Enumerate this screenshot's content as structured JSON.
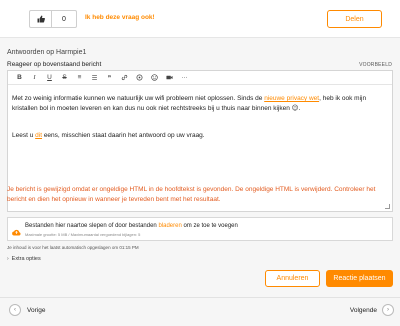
{
  "question_actions": {
    "like_count": "0",
    "same_question_label": "Ik heb deze vraag ook!",
    "share_label": "Delen"
  },
  "answers": {
    "heading": "Antwoorden op Harmpie1",
    "respond_label": "Reageer op bovenstaand bericht",
    "preview_label": "VOORBEELD"
  },
  "toolbar": {
    "bold": "B",
    "italic": "I",
    "underline": "U",
    "strike": "S",
    "list_ordered": "≡",
    "list_unordered": "☰",
    "quote": "❞",
    "link": "🔗",
    "image": "⊘",
    "emoji": "☺",
    "video": "■",
    "code": "<>",
    "more": "···"
  },
  "editor_content": {
    "p1_before": "Met zo weinig informatie kunnen we natuurlijk uw wifi probleem niet oplossen. Sinds de ",
    "p1_link": "nieuwe privacy wet",
    "p1_after": ", heb ik ook mijn kristallen bol in moeten leveren en kan dus nu ook niet rechtstreeks bij u thuis naar binnen kijken ",
    "p1_emoji": "😉",
    "p1_end": ".",
    "p2_before": "Leest u ",
    "p2_link": "dit",
    "p2_after": " eens, misschien staat daarin het antwoord op uw vraag."
  },
  "error_message": "Je bericht is gewijzigd omdat er ongeldige HTML in de hoofdtekst is gevonden. De ongeldige HTML is verwijderd. Controleer het bericht en dien het opnieuw in wanneer je tevreden bent met het resultaat.",
  "upload": {
    "text_before": "Bestanden hier naartoe slepen of door bestanden ",
    "browse_link": "bladeren",
    "text_after": " om ze toe te voegen",
    "limits": "Maximale grootte: 5 MB / Maximumaantal vergoedend bijlagen: 5"
  },
  "autosave": "Je inhoud is voor het laatst automatisch opgeslagen om 01:15 PM",
  "extra_options": "Extra opties",
  "buttons": {
    "cancel": "Annuleren",
    "post": "Reactie plaatsen"
  },
  "pager": {
    "prev": "Vorige",
    "next": "Volgende"
  },
  "colors": {
    "accent": "#ff8a00",
    "error": "#e35b1f"
  }
}
